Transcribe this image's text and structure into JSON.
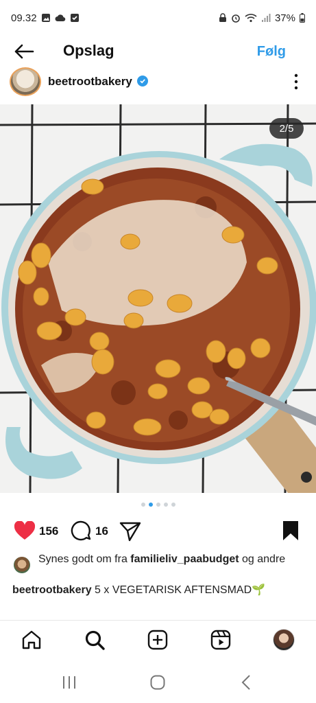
{
  "status_bar": {
    "time": "09.32",
    "battery": "37%"
  },
  "header": {
    "title": "Opslag",
    "follow_label": "Følg"
  },
  "author": {
    "username": "beetrootbakery"
  },
  "media": {
    "counter": "2/5",
    "dots_total": 5,
    "dots_active_index": 1
  },
  "actions": {
    "likes": "156",
    "comments": "16"
  },
  "liked_by": {
    "prefix": "Synes godt om fra ",
    "user": "familieliv_paabudget",
    "suffix": " og andre"
  },
  "caption": {
    "username": "beetrootbakery",
    "text": " 5 x VEGETARISK AFTENSMAD🌱"
  },
  "bottom_nav": {
    "items": [
      "home-icon",
      "search-icon",
      "create-icon",
      "reels-icon",
      "profile-avatar"
    ]
  },
  "system_nav": {
    "items": [
      "recents-icon",
      "home-circle-icon",
      "back-chevron-icon"
    ]
  },
  "colors": {
    "accent": "#2f9be8",
    "like": "#ed2f45",
    "pan": "#a9d3da"
  }
}
